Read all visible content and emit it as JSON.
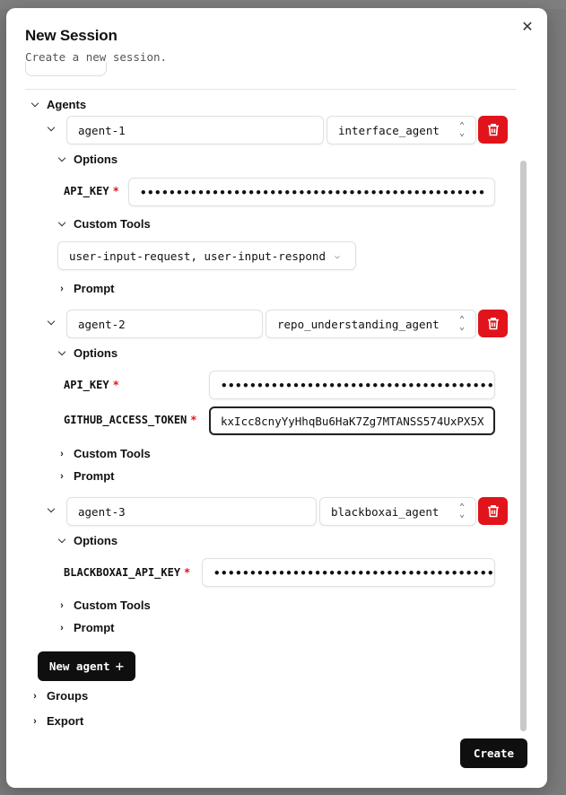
{
  "dialog": {
    "title": "New Session",
    "subtitle": "Create a new session.",
    "close_icon": "close-icon",
    "create_label": "Create"
  },
  "sections": {
    "agents_label": "Agents",
    "groups_label": "Groups",
    "export_label": "Export",
    "new_agent_label": "New agent",
    "new_agent_icon": "+"
  },
  "agents": [
    {
      "name": "agent-1",
      "type": "interface_agent",
      "options_label": "Options",
      "fields": [
        {
          "label": "API_KEY",
          "value": "••••••••••••••••••••••••••••••••••••••••••••••••",
          "masked": true
        }
      ],
      "custom_tools_label": "Custom Tools",
      "custom_tools_value": "user-input-request, user-input-respond",
      "prompt_label": "Prompt"
    },
    {
      "name": "agent-2",
      "type": "repo_understanding_agent",
      "options_label": "Options",
      "fields": [
        {
          "label": "API_KEY",
          "value": "••••••••••••••••••••••••••••••••••••••••",
          "masked": true
        },
        {
          "label": "GITHUB_ACCESS_TOKEN",
          "value": "kxIcc8cnyYyHhqBu6HaK7Zg7MTANSS574UxPX5X",
          "masked": false
        }
      ],
      "custom_tools_label": "Custom Tools",
      "prompt_label": "Prompt"
    },
    {
      "name": "agent-3",
      "type": "blackboxai_agent",
      "options_label": "Options",
      "fields": [
        {
          "label": "BLACKBOXAI_API_KEY",
          "value": "••••••••••••••••••••••••••••••••••••••••",
          "masked": true
        }
      ],
      "custom_tools_label": "Custom Tools",
      "prompt_label": "Prompt"
    }
  ],
  "colors": {
    "danger": "#e0141a",
    "primary_button": "#0f0f0f",
    "border": "#e0e0e0"
  }
}
